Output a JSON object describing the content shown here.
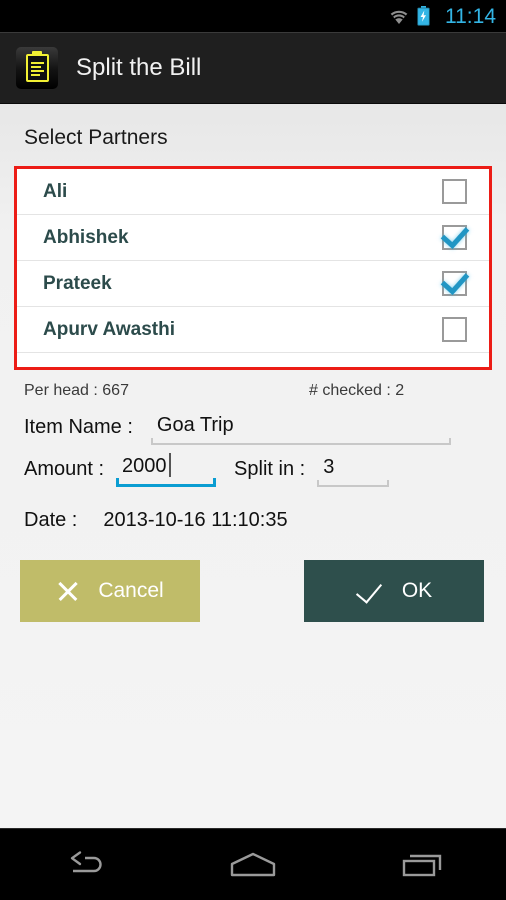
{
  "status_bar": {
    "time": "11:14",
    "wifi_icon": "wifi-icon",
    "battery_icon": "battery-charging-icon",
    "accent_color": "#33b5e5"
  },
  "action_bar": {
    "app_icon": "clipboard-icon",
    "title": "Split the Bill",
    "background": "#1f1f1f"
  },
  "main": {
    "section_title": "Select Partners",
    "highlight_border_color": "#ec1c16",
    "partners": [
      {
        "name": "Ali",
        "checked": false
      },
      {
        "name": "Abhishek",
        "checked": true
      },
      {
        "name": "Prateek",
        "checked": true
      },
      {
        "name": "Apurv Awasthi",
        "checked": false
      }
    ],
    "summary": {
      "per_head": "Per head : 667",
      "num_checked": "# checked : 2"
    },
    "fields": {
      "item_name_label": "Item Name :",
      "item_name_value": "Goa Trip",
      "amount_label": "Amount :",
      "amount_value": "2000",
      "split_in_label": "Split in :",
      "split_in_value": "3",
      "date_label": "Date :",
      "date_value": "2013-10-16 11:10:35",
      "focused_underline_color": "#0b9dd2"
    },
    "buttons": {
      "cancel_label": "Cancel",
      "cancel_color": "#c0bc69",
      "cancel_icon": "close-x-icon",
      "ok_label": "OK",
      "ok_color": "#2e4f4c",
      "ok_icon": "check-icon"
    }
  },
  "nav_bar": {
    "back": "back-icon",
    "home": "home-icon",
    "recents": "recents-icon"
  }
}
